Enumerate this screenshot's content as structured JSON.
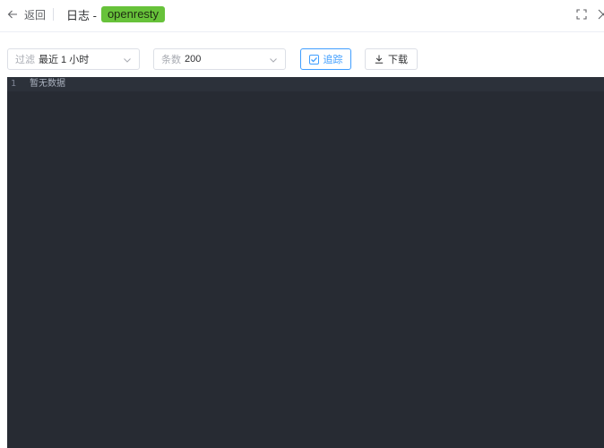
{
  "header": {
    "back_label": "返回",
    "title": "日志 -",
    "tag": "openresty",
    "tag_color": "#67c23a"
  },
  "toolbar": {
    "filter": {
      "prefix": "过滤",
      "value": "最近 1 小时"
    },
    "count": {
      "prefix": "条数",
      "value": "200"
    },
    "track_label": "追踪",
    "track_checked": true,
    "download_label": "下载",
    "accent_color": "#409eff"
  },
  "editor": {
    "background": "#272b33",
    "lines": [
      {
        "number": "1",
        "text": "暂无数据"
      }
    ]
  },
  "icons": {
    "back": "arrow-left-icon",
    "fullscreen": "fullscreen-icon",
    "close": "close-icon",
    "chevron": "chevron-down-icon",
    "check": "checkbox-checked-icon",
    "download": "download-icon"
  }
}
